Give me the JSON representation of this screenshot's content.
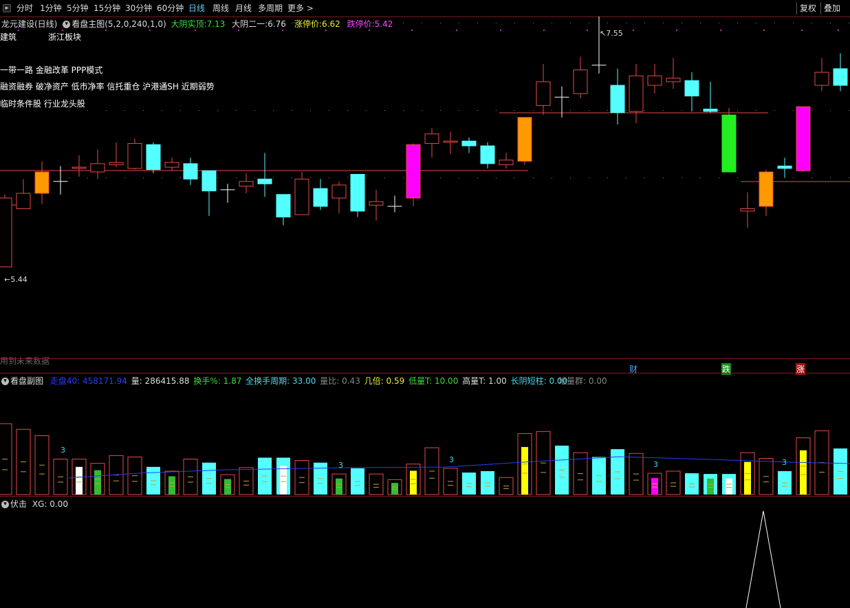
{
  "toolbar": {
    "tabs": [
      "分时",
      "1分钟",
      "5分钟",
      "15分钟",
      "30分钟",
      "60分钟",
      "日线",
      "周线",
      "月线",
      "多周期",
      "更多 >"
    ],
    "active": "日线",
    "right_buttons": [
      "复权",
      "叠加"
    ]
  },
  "main_info": {
    "stock": "龙元建设(日线)",
    "indicator": "看盘主图(5,2,0,240,1,0)",
    "dayin_label": "大阴实顶:",
    "dayin_value": "7.13",
    "dayin2_label": "大阴二一:",
    "dayin2_value": "6.76",
    "limit_up_label": "涨停价:",
    "limit_up_value": "6.62",
    "limit_down_label": "跌停价:",
    "limit_down_value": "5.42"
  },
  "overlay_text": {
    "industry": "建筑",
    "sector": "浙江板块",
    "concept1": "一带一路 金融改革 PPP模式",
    "concept2": "融资融券 破净资产 低市净率 信托重仓 沪港通SH 近期弱势",
    "concept3": "临时条件股 行业龙头股",
    "future_warn": "用到未来数据",
    "high_label": "7.55",
    "low_label": "5.44"
  },
  "markers": {
    "cai": "财",
    "die": "跌",
    "zhang": "涨"
  },
  "sub_info": {
    "name": "看盘副图",
    "items": [
      {
        "label": "走盘40:",
        "value": "458171.94",
        "color": "#2a3cff"
      },
      {
        "label": "量:",
        "value": "286415.88",
        "color": "#dddddd"
      },
      {
        "label": "换手%:",
        "value": "1.87",
        "color": "#3cdc3c"
      },
      {
        "label": "全换手周期:",
        "value": "33.00",
        "color": "#44ddee"
      },
      {
        "label": "量比:",
        "value": "0.43",
        "color": "#888888"
      },
      {
        "label": "几倍:",
        "value": "0.59",
        "color": "#eeee33"
      },
      {
        "label": "低量T:",
        "value": "10.00",
        "color": "#3cdc3c"
      },
      {
        "label": "高量T:",
        "value": "1.00",
        "color": "#dddddd"
      },
      {
        "label": "长阴短柱:",
        "value": "0.00",
        "color": "#44ddee"
      },
      {
        "label": "地量群:",
        "value": "0.00",
        "color": "#888888"
      }
    ],
    "marker_3": "3"
  },
  "ind_info": {
    "name": "伏击",
    "label": "XG:",
    "value": "0.00"
  },
  "colors": {
    "up": "#e84a4a",
    "down": "#54ffff",
    "orange": "#ff9900",
    "magenta": "#ff00ff",
    "green": "#22ee22",
    "yellow": "#ffff00",
    "white": "#ffffff"
  },
  "chart_data": {
    "type": "candlestick",
    "price_range": [
      5.44,
      7.55
    ],
    "candles": [
      {
        "o": 5.44,
        "c": 6.02,
        "h": 6.05,
        "l": 5.44,
        "s": "up"
      },
      {
        "o": 5.93,
        "c": 6.06,
        "h": 6.18,
        "l": 5.93,
        "s": "up"
      },
      {
        "o": 6.06,
        "c": 6.24,
        "h": 6.33,
        "l": 5.97,
        "s": "orange"
      },
      {
        "o": 6.16,
        "c": 6.16,
        "h": 6.29,
        "l": 6.05,
        "s": "cross"
      },
      {
        "o": 6.27,
        "c": 6.28,
        "h": 6.38,
        "l": 6.2,
        "s": "up"
      },
      {
        "o": 6.24,
        "c": 6.31,
        "h": 6.43,
        "l": 6.18,
        "s": "up"
      },
      {
        "o": 6.3,
        "c": 6.32,
        "h": 6.49,
        "l": 6.28,
        "s": "up"
      },
      {
        "o": 6.27,
        "c": 6.48,
        "h": 6.52,
        "l": 6.26,
        "s": "up"
      },
      {
        "o": 6.47,
        "c": 6.26,
        "h": 6.49,
        "l": 6.23,
        "s": "down"
      },
      {
        "o": 6.28,
        "c": 6.32,
        "h": 6.36,
        "l": 6.25,
        "s": "up"
      },
      {
        "o": 6.31,
        "c": 6.18,
        "h": 6.36,
        "l": 6.13,
        "s": "down"
      },
      {
        "o": 6.25,
        "c": 6.08,
        "h": 6.25,
        "l": 5.87,
        "s": "down"
      },
      {
        "o": 6.09,
        "c": 6.09,
        "h": 6.14,
        "l": 5.98,
        "s": "cross"
      },
      {
        "o": 6.12,
        "c": 6.16,
        "h": 6.23,
        "l": 6.06,
        "s": "up"
      },
      {
        "o": 6.18,
        "c": 6.14,
        "h": 6.4,
        "l": 6.03,
        "s": "down"
      },
      {
        "o": 6.05,
        "c": 5.86,
        "h": 6.05,
        "l": 5.79,
        "s": "down"
      },
      {
        "o": 5.88,
        "c": 6.18,
        "h": 6.24,
        "l": 5.88,
        "s": "up"
      },
      {
        "o": 6.1,
        "c": 5.95,
        "h": 6.18,
        "l": 5.92,
        "s": "down"
      },
      {
        "o": 6.02,
        "c": 6.13,
        "h": 6.16,
        "l": 5.89,
        "s": "up"
      },
      {
        "o": 6.22,
        "c": 5.91,
        "h": 6.22,
        "l": 5.86,
        "s": "down"
      },
      {
        "o": 5.96,
        "c": 5.99,
        "h": 6.09,
        "l": 5.83,
        "s": "up"
      },
      {
        "o": 5.95,
        "c": 5.95,
        "h": 6.04,
        "l": 5.9,
        "s": "cross"
      },
      {
        "o": 6.02,
        "c": 6.47,
        "h": 6.48,
        "l": 5.95,
        "s": "magenta"
      },
      {
        "o": 6.48,
        "c": 6.56,
        "h": 6.61,
        "l": 6.36,
        "s": "up"
      },
      {
        "o": 6.49,
        "c": 6.5,
        "h": 6.58,
        "l": 6.39,
        "s": "up"
      },
      {
        "o": 6.5,
        "c": 6.46,
        "h": 6.53,
        "l": 6.4,
        "s": "down"
      },
      {
        "o": 6.46,
        "c": 6.31,
        "h": 6.49,
        "l": 6.27,
        "s": "down"
      },
      {
        "o": 6.3,
        "c": 6.34,
        "h": 6.4,
        "l": 6.27,
        "s": "up"
      },
      {
        "o": 6.33,
        "c": 6.7,
        "h": 6.7,
        "l": 6.3,
        "s": "orange"
      },
      {
        "o": 6.8,
        "c": 7.0,
        "h": 7.15,
        "l": 6.72,
        "s": "up"
      },
      {
        "o": 6.87,
        "c": 6.87,
        "h": 6.96,
        "l": 6.7,
        "s": "cross"
      },
      {
        "o": 6.9,
        "c": 7.1,
        "h": 7.21,
        "l": 6.86,
        "s": "up"
      },
      {
        "o": 7.14,
        "c": 7.14,
        "h": 7.55,
        "l": 7.07,
        "s": "cross"
      },
      {
        "o": 6.97,
        "c": 6.74,
        "h": 7.11,
        "l": 6.64,
        "s": "down"
      },
      {
        "o": 6.75,
        "c": 7.05,
        "h": 7.15,
        "l": 6.65,
        "s": "up"
      },
      {
        "o": 6.97,
        "c": 7.05,
        "h": 7.15,
        "l": 6.9,
        "s": "up"
      },
      {
        "o": 7.0,
        "c": 7.03,
        "h": 7.2,
        "l": 6.94,
        "s": "up"
      },
      {
        "o": 7.01,
        "c": 6.88,
        "h": 7.08,
        "l": 6.75,
        "s": "down"
      },
      {
        "o": 6.77,
        "c": 6.75,
        "h": 7.0,
        "l": 6.74,
        "s": "down"
      },
      {
        "o": 6.72,
        "c": 6.24,
        "h": 6.78,
        "l": 6.24,
        "s": "green"
      },
      {
        "o": 5.91,
        "c": 5.93,
        "h": 6.07,
        "l": 5.77,
        "s": "up"
      },
      {
        "o": 5.95,
        "c": 6.24,
        "h": 6.26,
        "l": 5.87,
        "s": "orange"
      },
      {
        "o": 6.29,
        "c": 6.27,
        "h": 6.36,
        "l": 6.19,
        "s": "down"
      },
      {
        "o": 6.25,
        "c": 6.79,
        "h": 6.79,
        "l": 6.24,
        "s": "magenta"
      },
      {
        "o": 6.97,
        "c": 7.08,
        "h": 7.2,
        "l": 6.92,
        "s": "up"
      },
      {
        "o": 7.11,
        "c": 6.97,
        "h": 7.24,
        "l": 6.92,
        "s": "down"
      }
    ],
    "volume_bars": [
      {
        "v": 1.0,
        "s": "up"
      },
      {
        "v": 0.92,
        "s": "up"
      },
      {
        "v": 0.83,
        "s": "up"
      },
      {
        "v": 0.5,
        "s": "up"
      },
      {
        "v": 0.5,
        "s": "up",
        "in": "white"
      },
      {
        "v": 0.44,
        "s": "up",
        "in": "green"
      },
      {
        "v": 0.55,
        "s": "up"
      },
      {
        "v": 0.53,
        "s": "up"
      },
      {
        "v": 0.39,
        "s": "down"
      },
      {
        "v": 0.33,
        "s": "up",
        "in": "green"
      },
      {
        "v": 0.5,
        "s": "up"
      },
      {
        "v": 0.45,
        "s": "down"
      },
      {
        "v": 0.28,
        "s": "up",
        "in": "green"
      },
      {
        "v": 0.38,
        "s": "up"
      },
      {
        "v": 0.52,
        "s": "down"
      },
      {
        "v": 0.52,
        "s": "down",
        "in": "white"
      },
      {
        "v": 0.48,
        "s": "up"
      },
      {
        "v": 0.45,
        "s": "down"
      },
      {
        "v": 0.29,
        "s": "up",
        "in": "green"
      },
      {
        "v": 0.37,
        "s": "down"
      },
      {
        "v": 0.29,
        "s": "up"
      },
      {
        "v": 0.21,
        "s": "up",
        "in": "green"
      },
      {
        "v": 0.43,
        "s": "up",
        "in": "yellow"
      },
      {
        "v": 0.66,
        "s": "up"
      },
      {
        "v": 0.37,
        "s": "up"
      },
      {
        "v": 0.31,
        "s": "down"
      },
      {
        "v": 0.33,
        "s": "down"
      },
      {
        "v": 0.24,
        "s": "up"
      },
      {
        "v": 0.86,
        "s": "up",
        "in": "yellow"
      },
      {
        "v": 0.89,
        "s": "up"
      },
      {
        "v": 0.69,
        "s": "down"
      },
      {
        "v": 0.59,
        "s": "up"
      },
      {
        "v": 0.53,
        "s": "down"
      },
      {
        "v": 0.64,
        "s": "down"
      },
      {
        "v": 0.58,
        "s": "up"
      },
      {
        "v": 0.3,
        "s": "up",
        "in": "magenta"
      },
      {
        "v": 0.33,
        "s": "up"
      },
      {
        "v": 0.3,
        "s": "down"
      },
      {
        "v": 0.29,
        "s": "down",
        "in": "green"
      },
      {
        "v": 0.29,
        "s": "down",
        "in": "white"
      },
      {
        "v": 0.59,
        "s": "up",
        "in": "yellow"
      },
      {
        "v": 0.51,
        "s": "up"
      },
      {
        "v": 0.33,
        "s": "down"
      },
      {
        "v": 0.8,
        "s": "up",
        "in": "yellow"
      },
      {
        "v": 0.9,
        "s": "up"
      },
      {
        "v": 0.65,
        "s": "down"
      },
      {
        "v": 0.98,
        "s": "down"
      }
    ]
  }
}
